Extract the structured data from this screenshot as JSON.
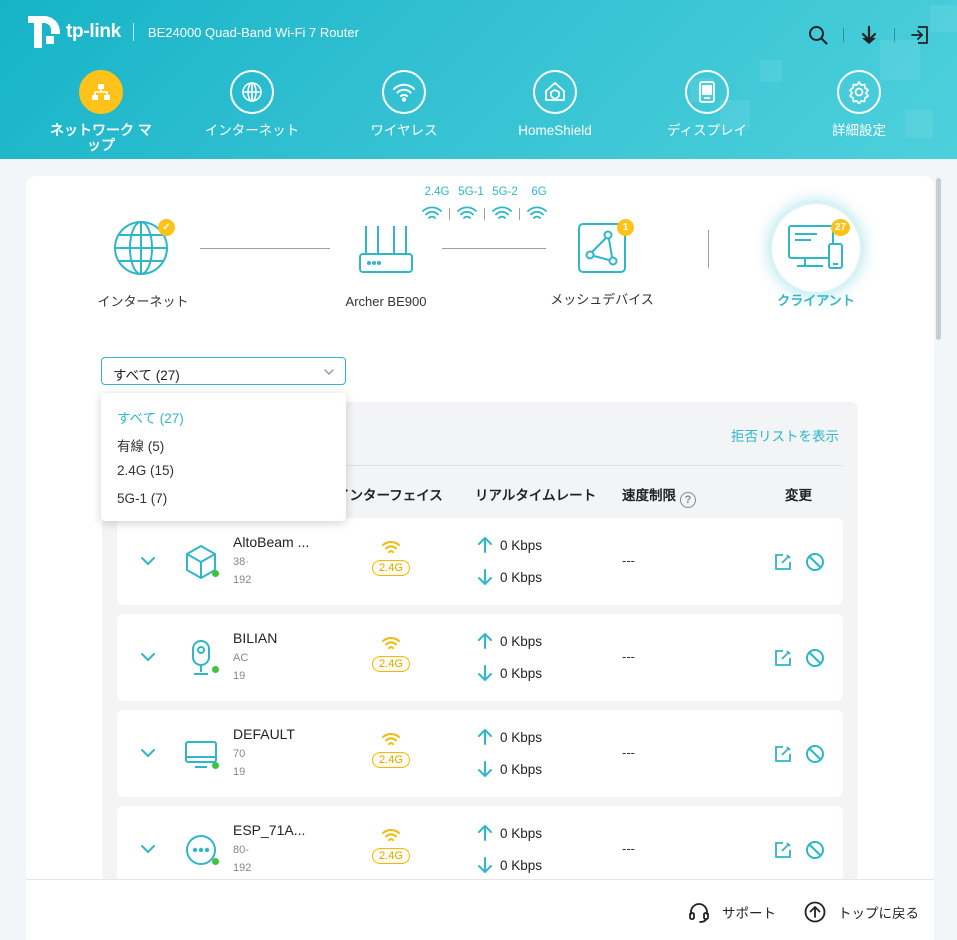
{
  "header": {
    "brand": "tp-link",
    "model": "BE24000 Quad-Band Wi-Fi 7 Router",
    "icons": [
      "search-icon",
      "download-icon",
      "logout-icon"
    ]
  },
  "nav": {
    "items": [
      {
        "label": "ネットワーク マップ",
        "icon": "network-map-icon",
        "active": true
      },
      {
        "label": "インターネット",
        "icon": "globe-icon",
        "active": false
      },
      {
        "label": "ワイヤレス",
        "icon": "wifi-icon",
        "active": false
      },
      {
        "label": "HomeShield",
        "icon": "homeshield-icon",
        "active": false
      },
      {
        "label": "ディスプレイ",
        "icon": "display-icon",
        "active": false
      },
      {
        "label": "詳細設定",
        "icon": "settings-icon",
        "active": false
      }
    ]
  },
  "topology": {
    "internet": {
      "label": "インターネット",
      "status": "check"
    },
    "router": {
      "label": "Archer BE900"
    },
    "bands": [
      "2.4G",
      "5G-1",
      "5G-2",
      "6G"
    ],
    "mesh": {
      "label": "メッシュデバイス",
      "badge": "1"
    },
    "clients": {
      "label": "クライアント",
      "badge": "27"
    }
  },
  "filter": {
    "selected": "すべて (27)",
    "options": [
      "すべて (27)",
      "有線 (5)",
      "2.4G (15)",
      "5G-1 (7)"
    ]
  },
  "table": {
    "blocklist_link": "拒否リストを表示",
    "headers": {
      "interface": "インターフェイス",
      "rate": "リアルタイムレート",
      "limit": "速度制限",
      "edit": "変更"
    },
    "rows": [
      {
        "name": "AltoBeam ...",
        "mac": "38·",
        "ip": "192",
        "icon": "cube-icon",
        "band": "2.4G",
        "up": "0 Kbps",
        "down": "0 Kbps",
        "limit": "---"
      },
      {
        "name": "BILIAN",
        "mac": "AC",
        "ip": "19",
        "icon": "camera-icon",
        "band": "2.4G",
        "up": "0 Kbps",
        "down": "0 Kbps",
        "limit": "---"
      },
      {
        "name": "DEFAULT",
        "mac": "70",
        "ip": "19",
        "icon": "tv-icon",
        "band": "2.4G",
        "up": "0 Kbps",
        "down": "0 Kbps",
        "limit": "---"
      },
      {
        "name": "ESP_71A...",
        "mac": "80-",
        "ip": "192",
        "icon": "more-icon",
        "band": "2.4G",
        "up": "0 Kbps",
        "down": "0 Kbps",
        "limit": "---"
      }
    ]
  },
  "footer": {
    "support": "サポート",
    "back_to_top": "トップに戻る"
  },
  "colors": {
    "header": "#1fb5c8",
    "accent": "#2db7c9",
    "active_nav": "#ffc21a",
    "band": "#f5b800",
    "online": "#3ec43e"
  }
}
